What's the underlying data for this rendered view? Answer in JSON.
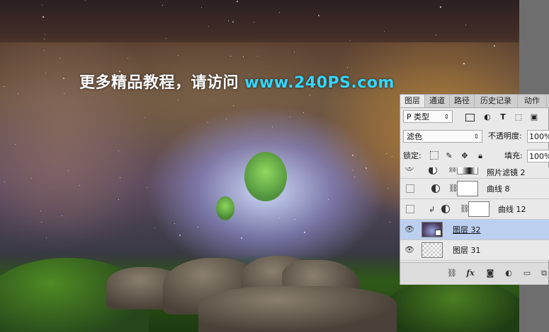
{
  "watermark": {
    "prefix": "更多精品教程，请访问 ",
    "url": "www.240PS.com"
  },
  "panel": {
    "tabs": [
      {
        "label": "图层",
        "active": true
      },
      {
        "label": "通道",
        "active": false
      },
      {
        "label": "路径",
        "active": false
      },
      {
        "label": "历史记录",
        "active": false
      },
      {
        "label": "动作",
        "active": false
      }
    ],
    "filter": {
      "value": "P 类型",
      "arrow": "⇕"
    },
    "blend_mode": {
      "value": "滤色",
      "arrow": "⇕"
    },
    "opacity": {
      "label": "不透明度:",
      "value": "100%"
    },
    "lock": {
      "label": "锁定:"
    },
    "fill": {
      "label": "填充:",
      "value": "100%"
    },
    "filter_icons": [
      "image-filter-icon",
      "adjustment-filter-icon",
      "type-filter-icon",
      "shape-filter-icon",
      "smart-object-filter-icon"
    ],
    "lock_icons": [
      "lock-transparent-icon",
      "lock-paint-icon",
      "lock-position-icon",
      "lock-all-icon"
    ],
    "layers": [
      {
        "name": "照片滤镜 2",
        "visible": true,
        "type": "adjustment",
        "partial": true
      },
      {
        "name": "曲线 8",
        "visible": false,
        "type": "adjustment"
      },
      {
        "name": "曲线 12",
        "visible": false,
        "type": "adjustment",
        "clipped": true
      },
      {
        "name": "图层 32",
        "visible": true,
        "type": "smart-photo",
        "selected": true
      },
      {
        "name": "图层 31",
        "visible": true,
        "type": "pixel"
      }
    ],
    "footer_icons": [
      "link-icon",
      "fx-icon",
      "mask-icon",
      "adjustment-icon",
      "group-icon",
      "new-layer-icon"
    ],
    "footer_fx": "fx"
  },
  "colors": {
    "selected_row": "#bccfef",
    "watermark_url": "#33d6ff"
  }
}
